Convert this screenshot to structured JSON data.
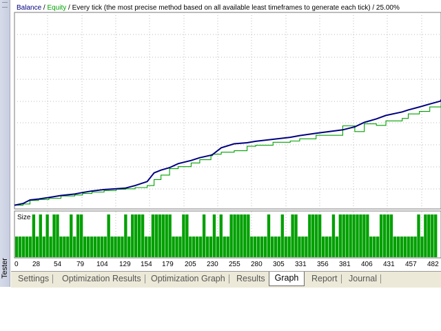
{
  "tester": {
    "side_label": "Tester"
  },
  "legend": {
    "balance": "Balance",
    "sep1": " / ",
    "equity": "Equity",
    "rest": " / Every tick (the most precise method based on all available least timeframes to generate each tick) / 25.00%"
  },
  "size_panel": {
    "label": "Size"
  },
  "colors": {
    "balance": "#000080",
    "equity": "#00a000",
    "size_bars": "#00a000",
    "grid": "#b8b8b8"
  },
  "chart_data": {
    "type": "line",
    "x_ticks": [
      "0",
      "28",
      "54",
      "79",
      "104",
      "129",
      "154",
      "179",
      "205",
      "230",
      "255",
      "280",
      "305",
      "331",
      "356",
      "381",
      "406",
      "431",
      "457",
      "482"
    ],
    "series": [
      {
        "name": "Balance",
        "x": [
          0,
          10,
          18,
          28,
          40,
          54,
          70,
          79,
          90,
          104,
          118,
          129,
          140,
          154,
          162,
          170,
          180,
          190,
          205,
          215,
          228,
          230,
          240,
          255,
          270,
          280,
          300,
          320,
          331,
          350,
          381,
          395,
          406,
          420,
          431,
          450,
          457,
          470,
          482,
          495
        ],
        "y": [
          0.5,
          1.2,
          2.6,
          3.0,
          3.6,
          4.4,
          5.0,
          5.6,
          6.2,
          6.8,
          7.1,
          7.4,
          8.4,
          10.0,
          13.5,
          14.6,
          15.6,
          17.2,
          18.5,
          19.6,
          20.6,
          20.9,
          23.6,
          25.2,
          25.6,
          26.2,
          27.0,
          27.8,
          28.5,
          29.4,
          30.8,
          32.0,
          33.8,
          35.2,
          36.6,
          38.0,
          38.8,
          40.0,
          41.2,
          42.4
        ]
      },
      {
        "name": "Equity",
        "x": [
          0,
          10,
          18,
          28,
          40,
          54,
          70,
          79,
          90,
          104,
          118,
          129,
          140,
          154,
          162,
          170,
          180,
          190,
          205,
          215,
          228,
          230,
          240,
          255,
          270,
          280,
          300,
          320,
          331,
          350,
          381,
          395,
          406,
          420,
          431,
          450,
          457,
          470,
          482,
          495
        ],
        "y": [
          0.5,
          1.0,
          2.4,
          2.8,
          3.3,
          4.2,
          4.6,
          5.2,
          5.8,
          6.4,
          6.9,
          7.1,
          7.6,
          8.4,
          10.8,
          12.6,
          15.2,
          16.0,
          17.5,
          18.8,
          20.4,
          21.0,
          21.8,
          22.4,
          24.2,
          24.6,
          25.8,
          26.3,
          27.2,
          28.6,
          32.4,
          30.1,
          33.2,
          32.6,
          34.4,
          35.4,
          37.2,
          38.2,
          40.0,
          41.0
        ]
      }
    ],
    "size_series": {
      "name": "Size",
      "levels": [
        1,
        1,
        1,
        1,
        1,
        2,
        1,
        2,
        1,
        2,
        1,
        2,
        2,
        1,
        1,
        1,
        2,
        1,
        2,
        2,
        1,
        1,
        1,
        1,
        1,
        1,
        1,
        2,
        1,
        1,
        1,
        1,
        2,
        1,
        2,
        2,
        2,
        2,
        1,
        1,
        2,
        2,
        2,
        2,
        2,
        2,
        1,
        1,
        1,
        2,
        2,
        1,
        1,
        1,
        1,
        2,
        1,
        1,
        2,
        1,
        2,
        1,
        1,
        2,
        2,
        2,
        2,
        2,
        2,
        1,
        1,
        1,
        1,
        1,
        2,
        1,
        1,
        1,
        2,
        1,
        1,
        2,
        2,
        1,
        1,
        1,
        2,
        2,
        2,
        2,
        1,
        1,
        1,
        2,
        1,
        2,
        2,
        2,
        2,
        2,
        2,
        2,
        2,
        2,
        1,
        1,
        1,
        2,
        2,
        2,
        2,
        1,
        1,
        1,
        1,
        1,
        1,
        1,
        2,
        1,
        2,
        2,
        2,
        2
      ]
    }
  },
  "tabs": [
    {
      "label": "Settings",
      "active": false
    },
    {
      "label": "Optimization Results",
      "active": false
    },
    {
      "label": "Optimization Graph",
      "active": false
    },
    {
      "label": "Results",
      "active": false
    },
    {
      "label": "Graph",
      "active": true
    },
    {
      "label": "Report",
      "active": false
    },
    {
      "label": "Journal",
      "active": false
    }
  ]
}
